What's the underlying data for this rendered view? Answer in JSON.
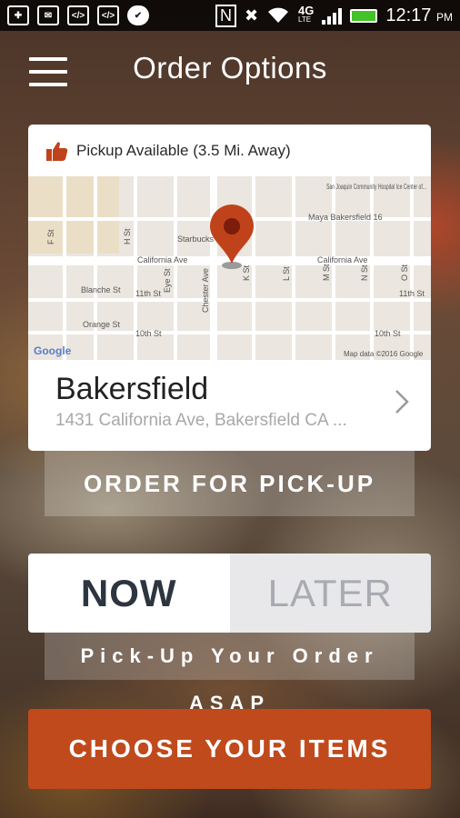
{
  "status_bar": {
    "network": "4G",
    "network_sub": "LTE",
    "time": "12:17",
    "ampm": "PM"
  },
  "header": {
    "title": "Order Options"
  },
  "card": {
    "pickup_text": "Pickup Available (3.5 Mi. Away)",
    "location_name": "Bakersfield",
    "location_address": "1431 California Ave, Bakersfield CA ...",
    "map": {
      "streets": [
        "California Ave",
        "California Ave",
        "11th St",
        "11th St",
        "Blanche St",
        "Orange St",
        "10th St",
        "10th St",
        "Chester Ave",
        "Eye St",
        "K St",
        "L St",
        "M St",
        "N St",
        "O St",
        "F St",
        "H St",
        "Starbucks"
      ],
      "pois": [
        "San Joaquin Community Hospital Ice Center of...",
        "Maya Bakersfield 16"
      ],
      "google_label": "Google",
      "attribution": "Map data ©2016 Google"
    }
  },
  "pickup_button": "ORDER FOR PICK-UP",
  "time_toggle": {
    "now": "NOW",
    "later": "LATER"
  },
  "asap_text": "Pick-Up Your Order ASAP",
  "choose_button": "CHOOSE YOUR ITEMS",
  "colors": {
    "accent": "#c04a1c",
    "pin": "#c0421b",
    "battery": "#43c22a"
  }
}
